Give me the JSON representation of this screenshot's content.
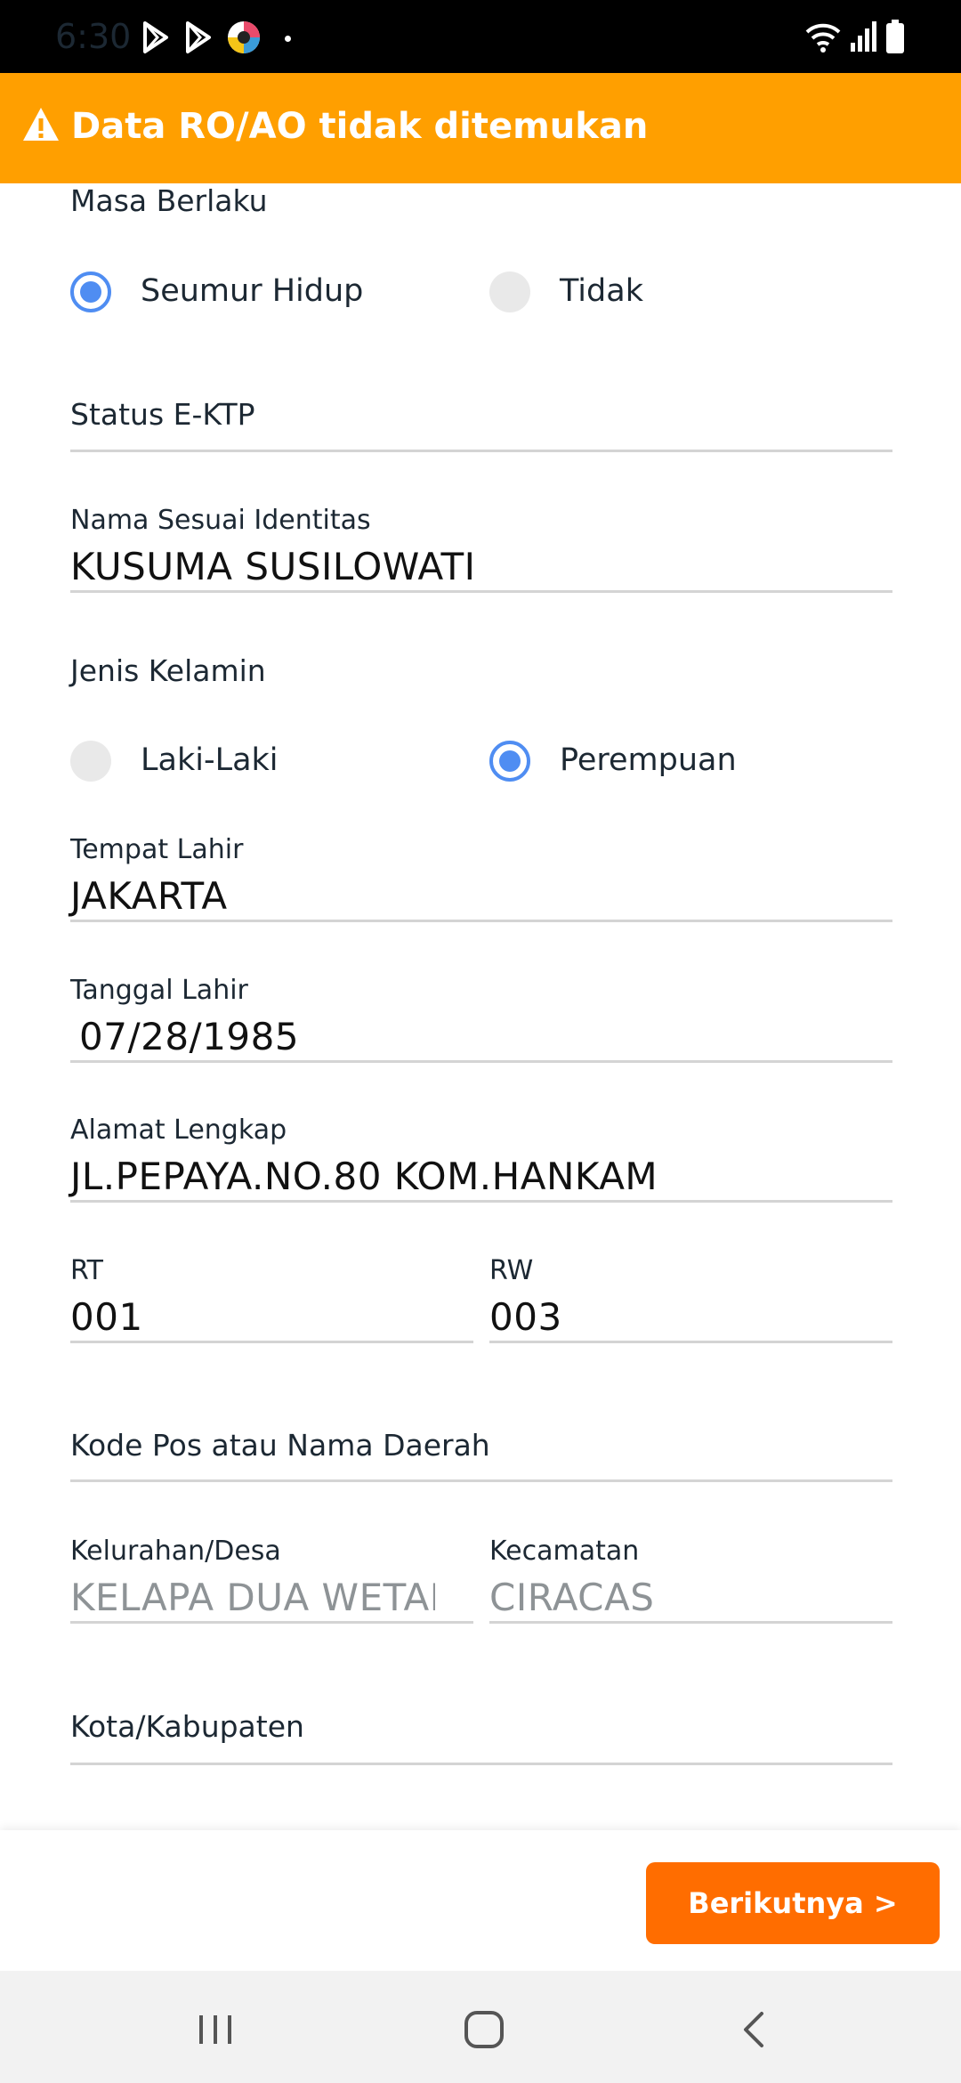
{
  "status_bar": {
    "time": "6:30",
    "icons": [
      "play-store-icon",
      "play-store-icon",
      "app-icon",
      "dot-icon",
      "wifi-icon",
      "signal-icon",
      "battery-icon"
    ]
  },
  "banner": {
    "icon": "warning-icon",
    "text": "Data RO/AO tidak ditemukan",
    "color": "#ff9f00"
  },
  "form": {
    "masa_berlaku": {
      "label": "Masa Berlaku",
      "options": [
        {
          "label": "Seumur Hidup",
          "selected": true
        },
        {
          "label": "Tidak",
          "selected": false
        }
      ]
    },
    "status_ektp": {
      "label": "Status E-KTP",
      "value": ""
    },
    "nama": {
      "label": "Nama Sesuai Identitas",
      "value": "KUSUMA SUSILOWATI"
    },
    "jenis_kelamin": {
      "label": "Jenis Kelamin",
      "options": [
        {
          "label": "Laki-Laki",
          "selected": false
        },
        {
          "label": "Perempuan",
          "selected": true
        }
      ]
    },
    "tempat_lahir": {
      "label": "Tempat Lahir",
      "value": "JAKARTA"
    },
    "tanggal_lahir": {
      "label": "Tanggal Lahir",
      "value": "07/28/1985"
    },
    "alamat": {
      "label": "Alamat Lengkap",
      "value": "JL.PEPAYA.NO.80 KOM.HANKAM"
    },
    "rt": {
      "label": "RT",
      "value": "001"
    },
    "rw": {
      "label": "RW",
      "value": "003"
    },
    "kode_pos": {
      "label": "Kode Pos atau Nama Daerah",
      "value": ""
    },
    "kelurahan": {
      "label": "Kelurahan/Desa",
      "value": "KELAPA DUA WETAI"
    },
    "kecamatan": {
      "label": "Kecamatan",
      "value": "CIRACAS"
    },
    "kota": {
      "label": "Kota/Kabupaten",
      "value": ""
    }
  },
  "actions": {
    "next_label": "Berikutnya >",
    "next_color": "#ff6d00"
  },
  "nav_bar": {
    "icons": [
      "recent-apps-icon",
      "home-icon",
      "back-icon"
    ]
  },
  "colors": {
    "radio_selected": "#4f8df2"
  }
}
